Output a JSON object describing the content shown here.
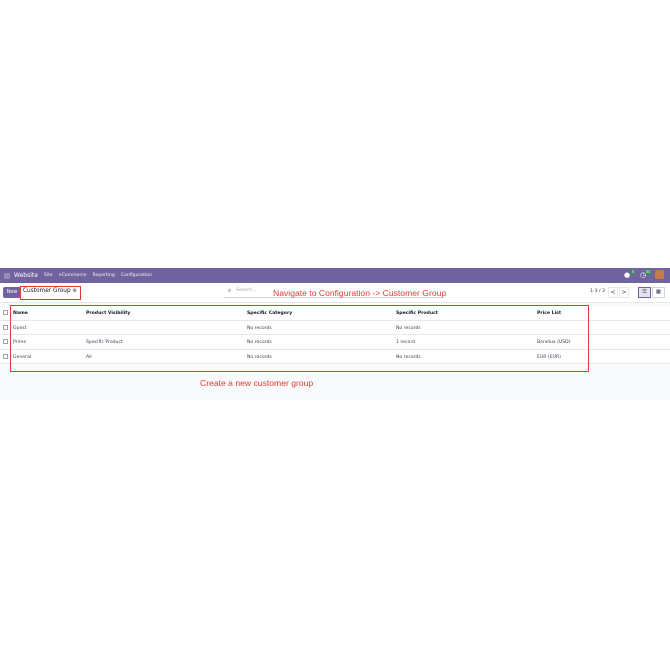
{
  "navbar": {
    "app_name": "Website",
    "menu": [
      "Site",
      "eCommerce",
      "Reporting",
      "Configuration"
    ],
    "chat_badge": "5",
    "activity_badge": "33"
  },
  "control": {
    "new_label": "New",
    "breadcrumb": "Customer Group",
    "search_placeholder": "Search...",
    "pager": "1-3 / 3",
    "prev": "<",
    "next": ">"
  },
  "annotations": {
    "top": "Navigate to Configuration -> Customer Group",
    "bottom": "Create a new customer group"
  },
  "table": {
    "headers": [
      "Name",
      "Product Visibility",
      "Specific Category",
      "Specific Product",
      "Price List"
    ],
    "rows": [
      [
        "Guest",
        "",
        "No records",
        "No records",
        ""
      ],
      [
        "Prime",
        "Specific Product",
        "No records",
        "1 record",
        "Benelux (USD)"
      ],
      [
        "General",
        "All",
        "No records",
        "No records",
        "EUR (EUR)"
      ]
    ]
  },
  "colors": {
    "brand": "#71639e",
    "annotation": "#e53935"
  }
}
